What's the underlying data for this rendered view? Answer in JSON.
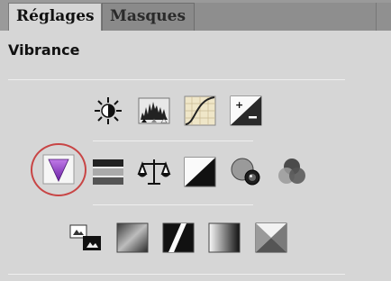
{
  "tabs": [
    {
      "label": "Réglages",
      "active": true
    },
    {
      "label": "Masques",
      "active": false
    }
  ],
  "panel": {
    "title": "Vibrance"
  },
  "icons": {
    "row1": [
      "brightness-contrast-icon",
      "levels-icon",
      "curves-icon",
      "exposure-icon"
    ],
    "row2": [
      "vibrance-icon",
      "hue-saturation-icon",
      "color-balance-icon",
      "black-white-icon",
      "photo-filter-icon",
      "channel-mixer-icon"
    ],
    "row3": [
      "invert-icon",
      "posterize-icon",
      "threshold-icon",
      "gradient-map-icon",
      "selective-color-icon"
    ]
  },
  "colors": {
    "highlight": "#c84545",
    "vibrance": "#9b3fd0"
  }
}
